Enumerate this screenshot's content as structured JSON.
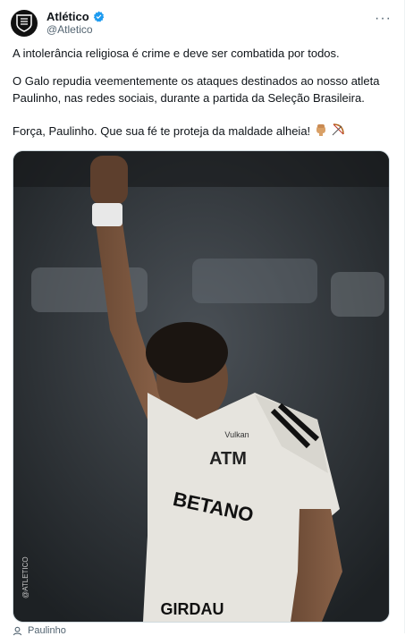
{
  "account": {
    "name": "Atlético",
    "handle": "@Atletico",
    "verified_color": "#1d9bf0"
  },
  "menu": {
    "more_label": "···"
  },
  "tweet": {
    "paragraphs": [
      "A intolerância religiosa é crime e deve ser combatida por todos.",
      "O Galo repudia veementemente os ataques destinados ao nosso atleta Paulinho, nas redes sociais, durante a partida da Seleção Brasileira.",
      "Força, Paulinho. Que sua fé te proteja da maldade alheia!"
    ],
    "emojis": [
      "raised-fist-icon",
      "bow-and-arrow-icon"
    ]
  },
  "media": {
    "sponsor": "BETANO",
    "brand": "ATM",
    "shirt_text": "Vulkan",
    "lower_sponsor": "GIRDAU",
    "side_handle": "@ATLETICO"
  },
  "tagged": {
    "label": "Paulinho"
  }
}
